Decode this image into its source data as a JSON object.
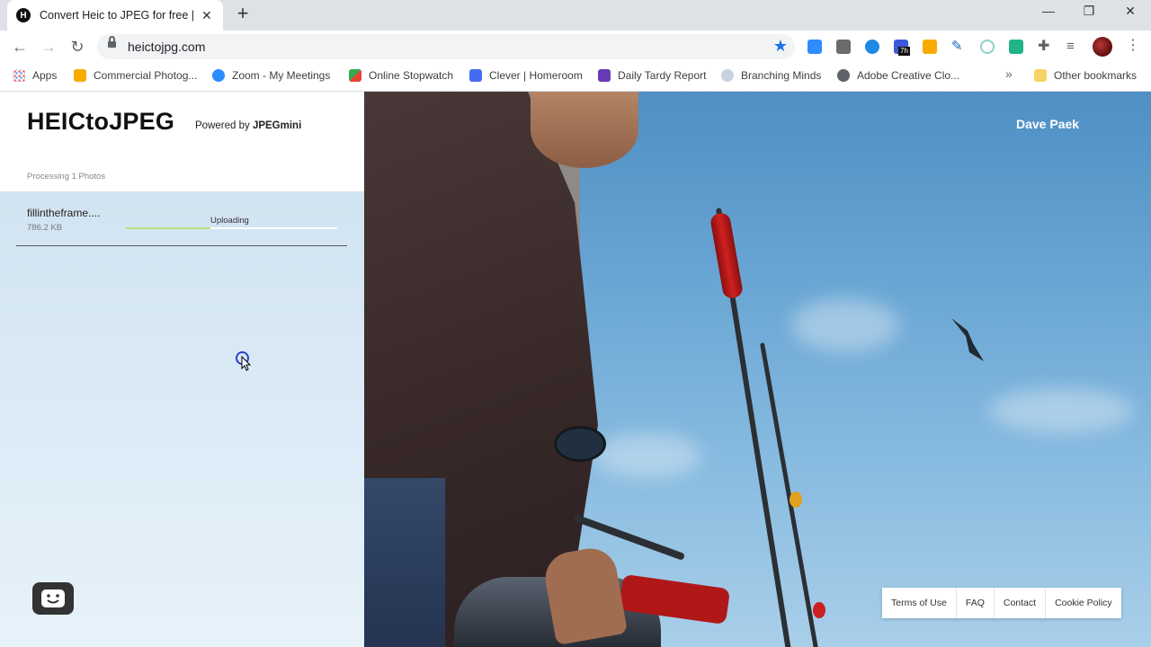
{
  "browser": {
    "tab": {
      "favicon_letter": "H",
      "title": "Convert Heic to JPEG for free | M"
    },
    "url": "heictojpg.com",
    "extension_badge": "7h",
    "bookmarks": [
      {
        "label": "Apps",
        "icon": "apps-grid-icon",
        "color": "#ea4335"
      },
      {
        "label": "Commercial Photog...",
        "icon": "google-classroom-icon",
        "color": "#f9ab00"
      },
      {
        "label": "Zoom - My Meetings",
        "icon": "zoom-icon",
        "color": "#2d8cff"
      },
      {
        "label": "Online Stopwatch",
        "icon": "stopwatch-icon",
        "color": "#34a853"
      },
      {
        "label": "Clever | Homeroom",
        "icon": "clever-icon",
        "color": "#436cf2"
      },
      {
        "label": "Daily Tardy Report",
        "icon": "forms-icon",
        "color": "#673ab7"
      },
      {
        "label": "Branching Minds",
        "icon": "branching-minds-icon",
        "color": "#c7d3e3"
      },
      {
        "label": "Adobe Creative Clo...",
        "icon": "creative-cloud-icon",
        "color": "#5f6368"
      }
    ],
    "other_bookmarks": "Other bookmarks",
    "more_bookmarks": "»"
  },
  "page": {
    "logo": "HEICtoJPEG",
    "powered_by_prefix": "Powered by",
    "powered_by_brand": "JPEGmini",
    "processing_text": "Processing 1 Photos",
    "file": {
      "name": "fillintheframe....",
      "size": "786.2 KB",
      "status": "Uploading",
      "progress": 0.4
    },
    "photo_credit": "Dave Paek",
    "footer_links": [
      "Terms of Use",
      "FAQ",
      "Contact",
      "Cookie Policy"
    ]
  }
}
